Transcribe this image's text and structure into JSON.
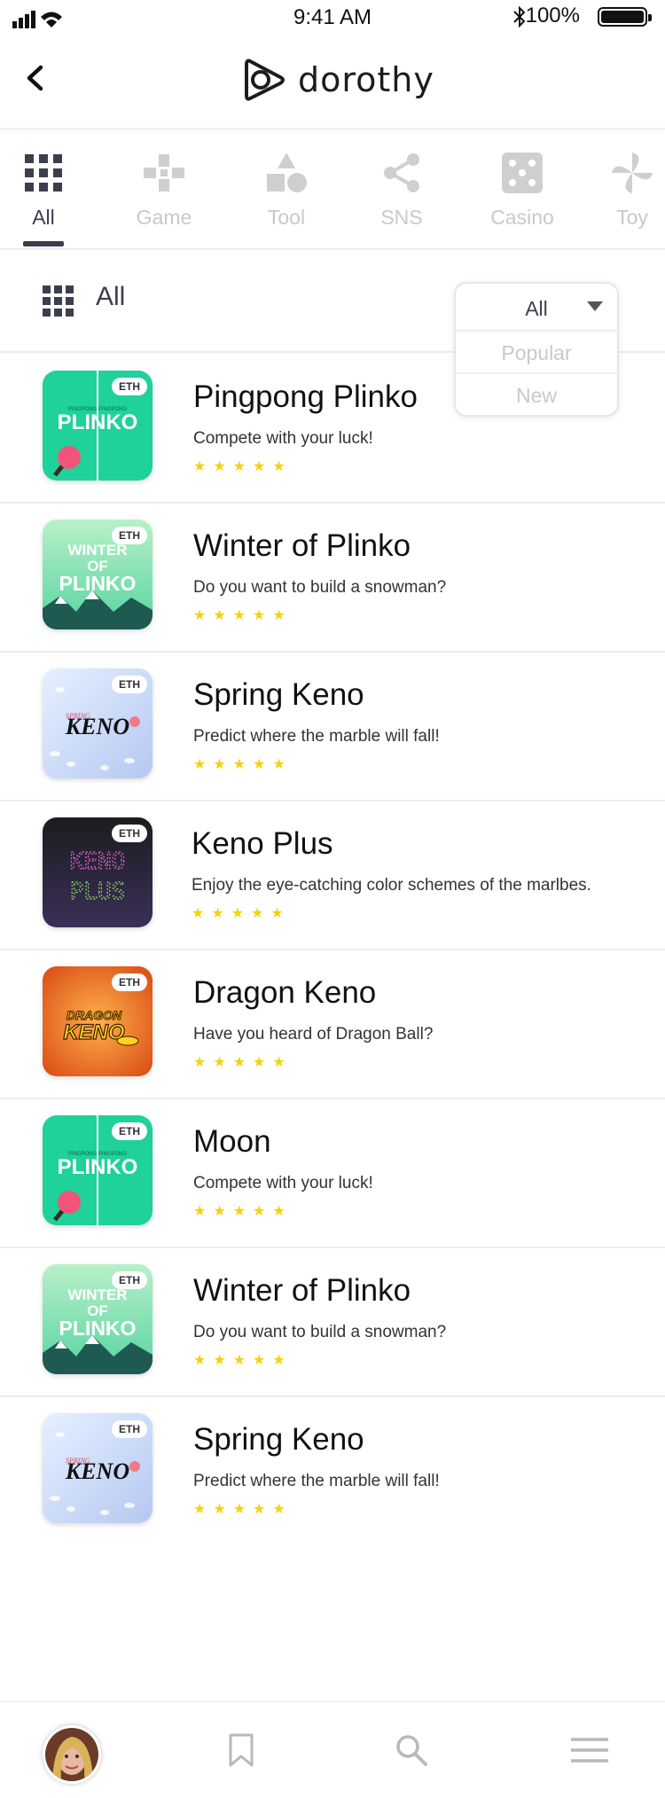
{
  "status_bar": {
    "time": "9:41 AM",
    "battery": "100%"
  },
  "header": {
    "app_name": "dorothy"
  },
  "tabs": [
    {
      "label": "All",
      "icon": "grid-icon",
      "active": true
    },
    {
      "label": "Game",
      "icon": "gamepad-icon"
    },
    {
      "label": "Tool",
      "icon": "shapes-icon"
    },
    {
      "label": "SNS",
      "icon": "share-icon"
    },
    {
      "label": "Casino",
      "icon": "dice-icon"
    },
    {
      "label": "Toy",
      "icon": "pinwheel-icon"
    }
  ],
  "filter": {
    "label": "All",
    "dropdown": {
      "selected": "All",
      "options": [
        "Popular",
        "New"
      ]
    }
  },
  "games": [
    {
      "title": "Pingpong Plinko",
      "description": "Compete with your luck!",
      "badge": "ETH",
      "art": "plinko",
      "stars": "★★★★★"
    },
    {
      "title": "Winter of Plinko",
      "description": "Do you want to build a snowman?",
      "badge": "ETH",
      "art": "winter",
      "stars": "★★★★★"
    },
    {
      "title": "Spring Keno",
      "description": "Predict where the marble will fall!",
      "badge": "ETH",
      "art": "spring",
      "stars": "★★★★★"
    },
    {
      "title": "Keno Plus",
      "description": "Enjoy the eye-catching color schemes of the marlbes.",
      "badge": "ETH",
      "art": "kenoplus",
      "stars": "★★★★★"
    },
    {
      "title": "Dragon Keno",
      "description": "Have you heard of Dragon Ball?",
      "badge": "ETH",
      "art": "dragon",
      "stars": "★★★★★"
    },
    {
      "title": "Moon",
      "description": "Compete with your luck!",
      "badge": "ETH",
      "art": "plinko",
      "stars": "★★★★★"
    },
    {
      "title": "Winter of Plinko",
      "description": "Do you want to build a snowman?",
      "badge": "ETH",
      "art": "winter",
      "stars": "★★★★★"
    },
    {
      "title": "Spring Keno",
      "description": "Predict where the marble will fall!",
      "badge": "ETH",
      "art": "spring",
      "stars": "★★★★★"
    }
  ],
  "thumb_text": {
    "plinko": "PLINKO",
    "plinko_small": "PINGPONG PINGPONG",
    "winter": [
      "WINTER",
      "OF",
      "PLINKO"
    ],
    "spring_small": "SPRING",
    "spring": "KENO",
    "kenoplus": [
      "KENO",
      "PLUS"
    ],
    "dragon": [
      "DRAGON",
      "KENO"
    ]
  },
  "bottom_nav": [
    {
      "icon": "avatar"
    },
    {
      "icon": "bookmark-icon"
    },
    {
      "icon": "search-icon"
    },
    {
      "icon": "menu-icon"
    }
  ],
  "colors": {
    "accent": "#3b3f4d",
    "inactive": "#c9c9c9",
    "star": "#f5d20a",
    "plinko_green": "#1fd19a"
  }
}
